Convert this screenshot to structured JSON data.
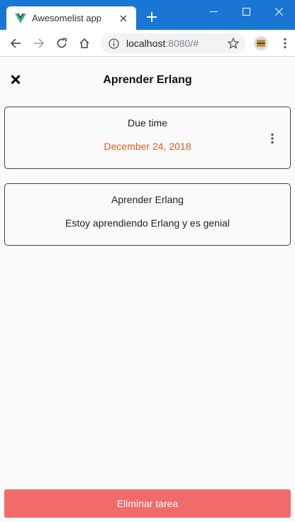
{
  "browser": {
    "tab_title": "Awesomelist app",
    "url_host": "localhost",
    "url_rest": ":8080/#",
    "favicon": "vue-logo-icon",
    "accent": "#1976d2"
  },
  "app": {
    "title": "Aprender Erlang",
    "due_card": {
      "label": "Due time",
      "date": "December 24, 2018",
      "date_color": "#e8581c"
    },
    "task_card": {
      "title": "Aprender Erlang",
      "description": "Estoy aprendiendo Erlang y es genial"
    },
    "delete_label": "Eliminar tarea",
    "delete_color": "#f26b6b"
  }
}
